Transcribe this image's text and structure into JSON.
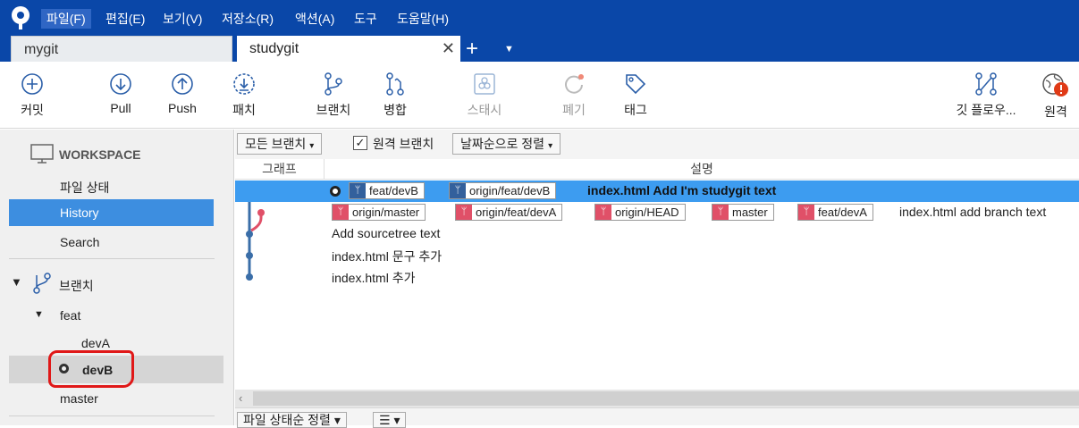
{
  "menu": {
    "items": [
      "파일(F)",
      "편집(E)",
      "보기(V)",
      "저장소(R)",
      "액션(A)",
      "도구",
      "도움말(H)"
    ]
  },
  "tabs": {
    "inactive": "mygit",
    "active": "studygit",
    "close": "✕",
    "add": "+"
  },
  "toolbar": {
    "commit": "커밋",
    "pull": "Pull",
    "push": "Push",
    "patch": "패치",
    "branch": "브랜치",
    "merge": "병합",
    "stash": "스태시",
    "discard": "폐기",
    "tag": "태그",
    "gitflow": "깃 플로우...",
    "remote": "원격"
  },
  "sidebar": {
    "workspace": "WORKSPACE",
    "file_status": "파일 상태",
    "history": "History",
    "search": "Search",
    "branches": "브랜치",
    "feat": "feat",
    "devA": "devA",
    "devB": "devB",
    "master": "master"
  },
  "filters": {
    "all_branches": "모든 브랜치",
    "remote_branches": "원격 브랜치",
    "sort": "날짜순으로 정렬"
  },
  "columns": {
    "graph": "그래프",
    "description": "설명"
  },
  "commits": [
    {
      "tags": [
        {
          "label": "feat/devB",
          "color": "blue"
        },
        {
          "label": "origin/feat/devB",
          "color": "blue"
        }
      ],
      "message": "index.html Add I'm studygit text"
    },
    {
      "tags": [
        {
          "label": "origin/master",
          "color": "red"
        },
        {
          "label": "origin/feat/devA",
          "color": "red"
        },
        {
          "label": "origin/HEAD",
          "color": "red"
        },
        {
          "label": "master",
          "color": "red"
        },
        {
          "label": "feat/devA",
          "color": "red"
        }
      ],
      "message": "index.html add branch text"
    },
    {
      "tags": [],
      "message": "Add sourcetree text"
    },
    {
      "tags": [],
      "message": "index.html 문구 추가"
    },
    {
      "tags": [],
      "message": "index.html 추가"
    }
  ],
  "bottom": {
    "sort_files": "파일 상태순 정렬",
    "list_icon": "☰"
  },
  "colors": {
    "menubar": "#0a47a8",
    "selection": "#3d9cf0",
    "graph_blue": "#3a6ea8",
    "graph_red": "#e05068",
    "annotation_red": "#e01818"
  }
}
